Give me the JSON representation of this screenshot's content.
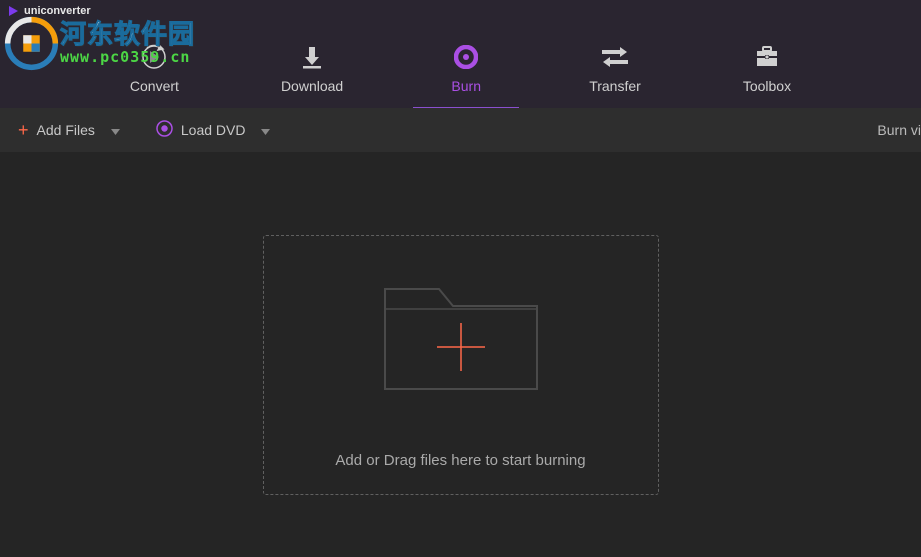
{
  "app": {
    "title": "uniconverter"
  },
  "watermark": {
    "cn_text": "河东软件园",
    "url_text": "www.pc0359.cn"
  },
  "nav": {
    "tabs": [
      {
        "label": "Convert",
        "active": false
      },
      {
        "label": "Download",
        "active": false
      },
      {
        "label": "Burn",
        "active": true
      },
      {
        "label": "Transfer",
        "active": false
      },
      {
        "label": "Toolbox",
        "active": false
      }
    ]
  },
  "actionbar": {
    "add_files_label": "Add Files",
    "load_dvd_label": "Load DVD",
    "right_text": "Burn vi"
  },
  "dropzone": {
    "text": "Add or Drag files here to start burning"
  }
}
